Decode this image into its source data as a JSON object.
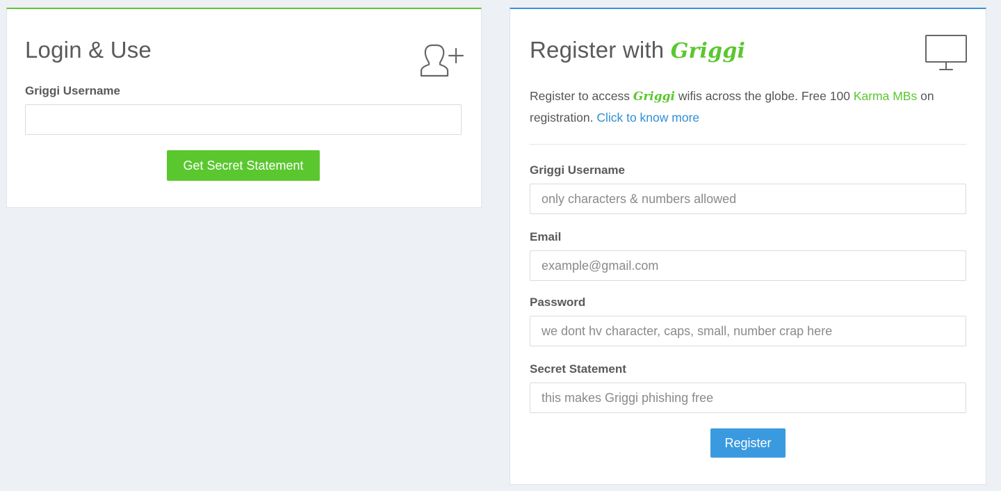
{
  "login": {
    "title": "Login & Use",
    "icon": "add-user-icon",
    "username_label": "Griggi Username",
    "username_value": "",
    "username_placeholder": "",
    "button_label": "Get Secret Statement"
  },
  "register": {
    "title_prefix": "Register with",
    "title_brand": "Griggi",
    "icon": "monitor-icon",
    "intro": {
      "part1": "Register to access",
      "brand": "Griggi",
      "part2": "wifis across the globe. Free 100",
      "karma": "Karma MBs",
      "part3": "on registration.",
      "link": "Click to know more"
    },
    "fields": {
      "username": {
        "label": "Griggi Username",
        "placeholder": "only characters & numbers allowed"
      },
      "email": {
        "label": "Email",
        "placeholder": "example@gmail.com"
      },
      "password": {
        "label": "Password",
        "placeholder": "we dont hv character, caps, small, number crap here"
      },
      "secret": {
        "label": "Secret Statement",
        "placeholder": "this makes Griggi phishing free"
      }
    },
    "button_label": "Register"
  },
  "colors": {
    "brand_green": "#5ac72f",
    "accent_blue": "#3a9ae0",
    "link_blue": "#2e8fd6",
    "background": "#edf0f4"
  }
}
